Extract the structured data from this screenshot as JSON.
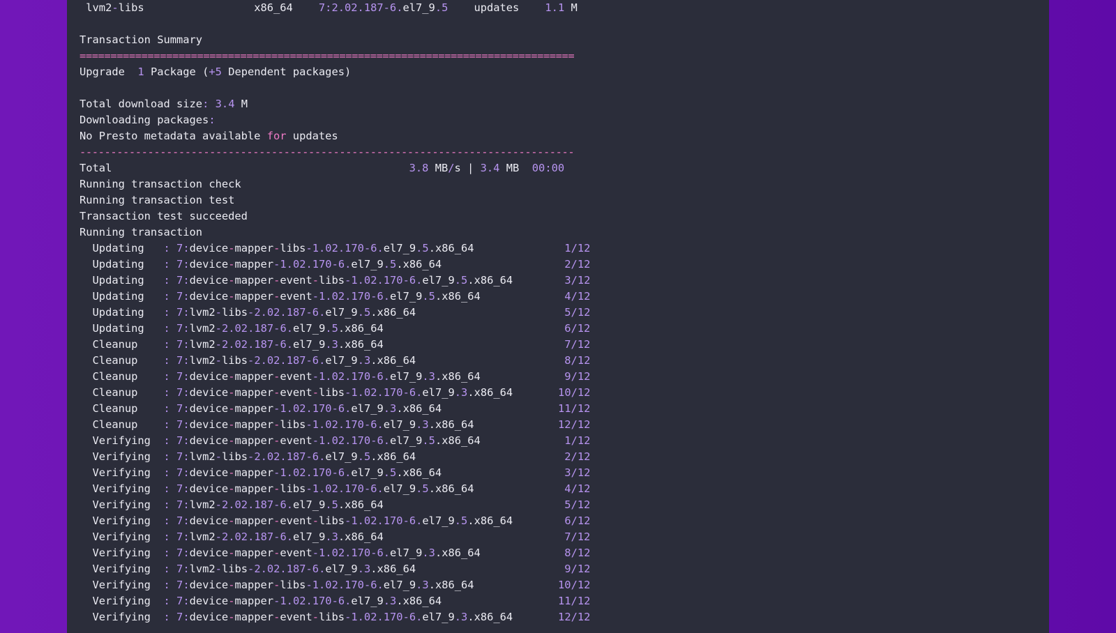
{
  "colors": {
    "background": "#6a12b0",
    "terminal_bg": "#2b2d3a",
    "text": "#ebebf2",
    "number": "#b794f0",
    "keyword": "#f07bc7"
  },
  "terminal": {
    "lines": [
      " lvm2-libs                 x86_64    7:2.02.187-6.el7_9.5    updates    1.1 M",
      "",
      "Transaction Summary",
      "================================================================================",
      "Upgrade  1 Package (+5 Dependent packages)",
      "",
      "Total download size: 3.4 M",
      "Downloading packages:",
      "No Presto metadata available for updates",
      "--------------------------------------------------------------------------------",
      "Total                                              3.8 MB/s | 3.4 MB  00:00",
      "Running transaction check",
      "Running transaction test",
      "Transaction test succeeded",
      "Running transaction",
      "  Updating   : 7:device-mapper-libs-1.02.170-6.el7_9.5.x86_64              1/12",
      "  Updating   : 7:device-mapper-1.02.170-6.el7_9.5.x86_64                   2/12",
      "  Updating   : 7:device-mapper-event-libs-1.02.170-6.el7_9.5.x86_64        3/12",
      "  Updating   : 7:device-mapper-event-1.02.170-6.el7_9.5.x86_64             4/12",
      "  Updating   : 7:lvm2-libs-2.02.187-6.el7_9.5.x86_64                       5/12",
      "  Updating   : 7:lvm2-2.02.187-6.el7_9.5.x86_64                            6/12",
      "  Cleanup    : 7:lvm2-2.02.187-6.el7_9.3.x86_64                            7/12",
      "  Cleanup    : 7:lvm2-libs-2.02.187-6.el7_9.3.x86_64                       8/12",
      "  Cleanup    : 7:device-mapper-event-1.02.170-6.el7_9.3.x86_64             9/12",
      "  Cleanup    : 7:device-mapper-event-libs-1.02.170-6.el7_9.3.x86_64       10/12",
      "  Cleanup    : 7:device-mapper-1.02.170-6.el7_9.3.x86_64                  11/12",
      "  Cleanup    : 7:device-mapper-libs-1.02.170-6.el7_9.3.x86_64             12/12",
      "  Verifying  : 7:device-mapper-event-1.02.170-6.el7_9.5.x86_64             1/12",
      "  Verifying  : 7:lvm2-libs-2.02.187-6.el7_9.5.x86_64                       2/12",
      "  Verifying  : 7:device-mapper-1.02.170-6.el7_9.5.x86_64                   3/12",
      "  Verifying  : 7:device-mapper-libs-1.02.170-6.el7_9.5.x86_64              4/12",
      "  Verifying  : 7:lvm2-2.02.187-6.el7_9.5.x86_64                            5/12",
      "  Verifying  : 7:device-mapper-event-libs-1.02.170-6.el7_9.5.x86_64        6/12",
      "  Verifying  : 7:lvm2-2.02.187-6.el7_9.3.x86_64                            7/12",
      "  Verifying  : 7:device-mapper-event-1.02.170-6.el7_9.3.x86_64             8/12",
      "  Verifying  : 7:lvm2-libs-2.02.187-6.el7_9.3.x86_64                       9/12",
      "  Verifying  : 7:device-mapper-libs-1.02.170-6.el7_9.3.x86_64             10/12",
      "  Verifying  : 7:device-mapper-1.02.170-6.el7_9.3.x86_64                  11/12",
      "  Verifying  : 7:device-mapper-event-libs-1.02.170-6.el7_9.3.x86_64       12/12"
    ]
  }
}
